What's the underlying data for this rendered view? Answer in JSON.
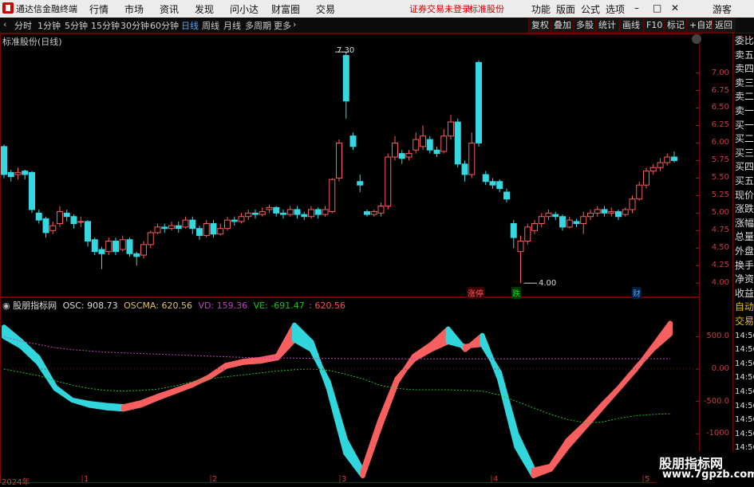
{
  "app": {
    "title": "通达信金融终端",
    "guest": "游客"
  },
  "menu": [
    "行情",
    "市场",
    "资讯",
    "发现",
    "问小达",
    "财富圈",
    "交易"
  ],
  "notice": {
    "login": "证券交易未登录",
    "stock": "标准股份"
  },
  "menu_right": [
    "功能",
    "版面",
    "公式",
    "选项"
  ],
  "periods": [
    "分时",
    "1分钟",
    "5分钟",
    "15分钟",
    "30分钟",
    "60分钟",
    "日线",
    "周线",
    "月线",
    "多周期",
    "更多"
  ],
  "active_period": "日线",
  "tool_buttons": [
    "复权",
    "叠加",
    "多股",
    "统计",
    "画线",
    "F10",
    "标记",
    "+自选",
    "返回"
  ],
  "chart_title": "标准股份(日线)",
  "colors": {
    "up": "#ff5a5a",
    "down": "#35d7e0",
    "osc_up": "#f86060",
    "osc_down": "#30d6dc",
    "vd": "#c040c0",
    "ve": "#20c020",
    "accent": "#4aa3ff"
  },
  "price_axis": [
    "7.00",
    "6.75",
    "6.50",
    "6.25",
    "6.00",
    "5.75",
    "5.50",
    "5.25",
    "5.00",
    "4.75",
    "4.50",
    "4.25",
    "4.00"
  ],
  "price_high_label": "7.30",
  "price_low_label": "4.00",
  "event_tags": [
    "涨停",
    "跌",
    "财"
  ],
  "indicator": {
    "name": "股朋指标网",
    "osc_label": "OSC: 908.73",
    "oscma_label": "OSCMA: 620.56",
    "vd_label": "VD: 159.36",
    "ve_label": "VE: -691.47",
    "extra_label": ": 620.56"
  },
  "osc_axis": [
    "500.0",
    "0.00",
    "-500.0",
    "-1000",
    "-1500"
  ],
  "date_axis": [
    "2024年",
    "1",
    "2",
    "3",
    "4",
    "5"
  ],
  "sidebar": [
    "委比",
    "卖五",
    "卖四",
    "卖三",
    "卖二",
    "卖一",
    "买一",
    "买二",
    "买三",
    "买四",
    "买五",
    "现价",
    "涨跌",
    "涨幅",
    "总量",
    "外盘",
    "换手",
    "净资",
    "收益",
    "自动",
    "交易",
    "14:56",
    "14:56",
    "14:56",
    "14:56",
    "14:56",
    "14:56",
    "14:56",
    "14:56",
    "14:56",
    "14:56"
  ],
  "watermark": {
    "line1": "股朋指标网",
    "line2": "www.7gpzb.com"
  },
  "chart_data": [
    {
      "type": "candlestick",
      "title": "标准股份(日线)",
      "ylim": [
        3.9,
        7.45
      ],
      "candles": [
        [
          5.95,
          5.55,
          5.98,
          5.5
        ],
        [
          5.58,
          5.52,
          5.62,
          5.45
        ],
        [
          5.55,
          5.58,
          5.65,
          5.48
        ],
        [
          5.6,
          5.55,
          5.62,
          5.48
        ],
        [
          5.58,
          5.05,
          5.6,
          5.0
        ],
        [
          5.0,
          4.9,
          5.05,
          4.85
        ],
        [
          4.92,
          4.72,
          4.95,
          4.65
        ],
        [
          4.75,
          4.82,
          4.88,
          4.7
        ],
        [
          4.85,
          5.02,
          5.1,
          4.8
        ],
        [
          5.0,
          4.95,
          5.05,
          4.88
        ],
        [
          4.95,
          4.85,
          4.98,
          4.78
        ],
        [
          4.88,
          4.88,
          4.95,
          4.8
        ],
        [
          4.88,
          4.6,
          4.9,
          4.52
        ],
        [
          4.62,
          4.45,
          4.65,
          4.4
        ],
        [
          4.48,
          4.42,
          4.52,
          4.2
        ],
        [
          4.45,
          4.6,
          4.65,
          4.4
        ],
        [
          4.6,
          4.45,
          4.65,
          4.4
        ],
        [
          4.48,
          4.62,
          4.68,
          4.45
        ],
        [
          4.62,
          4.42,
          4.65,
          4.38
        ],
        [
          4.42,
          4.38,
          4.45,
          4.25
        ],
        [
          4.4,
          4.55,
          4.6,
          4.35
        ],
        [
          4.55,
          4.72,
          4.75,
          4.5
        ],
        [
          4.72,
          4.8,
          4.85,
          4.7
        ],
        [
          4.8,
          4.78,
          4.85,
          4.72
        ],
        [
          4.78,
          4.82,
          4.88,
          4.75
        ],
        [
          4.82,
          4.78,
          4.88,
          4.72
        ],
        [
          4.8,
          4.9,
          4.95,
          4.78
        ],
        [
          4.9,
          4.78,
          4.95,
          4.7
        ],
        [
          4.78,
          4.68,
          4.82,
          4.62
        ],
        [
          4.68,
          4.85,
          4.9,
          4.65
        ],
        [
          4.85,
          4.7,
          4.9,
          4.65
        ],
        [
          4.7,
          4.78,
          4.85,
          4.68
        ],
        [
          4.78,
          4.9,
          4.95,
          4.75
        ],
        [
          4.9,
          4.88,
          4.95,
          4.82
        ],
        [
          4.88,
          4.95,
          5.0,
          4.85
        ],
        [
          4.95,
          5.0,
          5.05,
          4.9
        ],
        [
          5.0,
          4.98,
          5.05,
          4.92
        ],
        [
          4.98,
          5.02,
          5.08,
          4.95
        ],
        [
          5.05,
          5.08,
          5.12,
          5.0
        ],
        [
          5.08,
          5.0,
          5.1,
          4.95
        ],
        [
          5.0,
          4.98,
          5.05,
          4.92
        ],
        [
          4.98,
          5.05,
          5.1,
          4.95
        ],
        [
          5.05,
          4.98,
          5.1,
          4.92
        ],
        [
          4.98,
          4.95,
          5.02,
          4.9
        ],
        [
          4.95,
          5.05,
          5.1,
          4.92
        ],
        [
          5.05,
          4.98,
          5.08,
          4.92
        ],
        [
          4.98,
          5.05,
          5.1,
          4.95
        ],
        [
          5.02,
          5.48,
          5.5,
          5.0
        ],
        [
          5.5,
          6.0,
          6.05,
          5.45
        ],
        [
          7.25,
          6.6,
          7.3,
          6.35
        ],
        [
          6.1,
          5.95,
          6.15,
          5.9
        ],
        [
          5.45,
          5.4,
          5.55,
          5.3
        ],
        [
          5.02,
          4.98,
          5.05,
          4.95
        ],
        [
          4.98,
          5.02,
          5.05,
          4.95
        ],
        [
          5.0,
          5.1,
          5.15,
          4.95
        ],
        [
          5.1,
          5.8,
          5.85,
          5.05
        ],
        [
          5.8,
          6.0,
          6.1,
          5.75
        ],
        [
          5.85,
          5.78,
          5.9,
          5.7
        ],
        [
          5.8,
          5.85,
          5.9,
          5.75
        ],
        [
          5.9,
          6.05,
          6.15,
          5.85
        ],
        [
          5.95,
          6.1,
          6.25,
          5.9
        ],
        [
          6.05,
          5.9,
          6.1,
          5.85
        ],
        [
          5.9,
          5.85,
          5.95,
          5.8
        ],
        [
          5.88,
          6.1,
          6.2,
          5.85
        ],
        [
          6.1,
          6.3,
          6.4,
          6.05
        ],
        [
          6.3,
          5.7,
          6.35,
          5.65
        ],
        [
          5.7,
          5.55,
          5.75,
          5.45
        ],
        [
          5.55,
          6.0,
          6.15,
          5.5
        ],
        [
          7.15,
          6.0,
          7.18,
          5.95
        ],
        [
          5.55,
          5.45,
          5.6,
          5.4
        ],
        [
          5.45,
          5.4,
          5.5,
          5.35
        ],
        [
          5.45,
          5.35,
          5.48,
          5.3
        ],
        [
          5.3,
          5.2,
          5.35,
          5.15
        ],
        [
          4.85,
          4.65,
          4.9,
          4.5
        ],
        [
          4.45,
          4.6,
          4.68,
          4.0
        ],
        [
          4.6,
          4.8,
          4.85,
          4.55
        ],
        [
          4.75,
          4.85,
          4.9,
          4.7
        ],
        [
          4.85,
          4.95,
          5.0,
          4.8
        ],
        [
          4.95,
          5.0,
          5.05,
          4.9
        ],
        [
          4.98,
          4.95,
          5.02,
          4.9
        ],
        [
          4.95,
          4.8,
          4.98,
          4.75
        ],
        [
          4.8,
          4.9,
          4.95,
          4.78
        ],
        [
          4.88,
          4.85,
          4.92,
          4.8
        ],
        [
          4.85,
          4.95,
          5.02,
          4.7
        ],
        [
          4.95,
          5.0,
          5.05,
          4.9
        ],
        [
          5.0,
          5.05,
          5.1,
          4.95
        ],
        [
          5.05,
          5.0,
          5.1,
          4.95
        ],
        [
          5.0,
          5.02,
          5.08,
          4.95
        ],
        [
          5.02,
          4.95,
          5.05,
          4.9
        ],
        [
          4.98,
          5.05,
          5.08,
          4.95
        ],
        [
          5.05,
          5.2,
          5.25,
          5.0
        ],
        [
          5.2,
          5.4,
          5.45,
          5.18
        ],
        [
          5.4,
          5.6,
          5.65,
          5.35
        ],
        [
          5.6,
          5.65,
          5.7,
          5.55
        ],
        [
          5.65,
          5.72,
          5.78,
          5.6
        ],
        [
          5.72,
          5.8,
          5.85,
          5.68
        ],
        [
          5.8,
          5.75,
          5.88,
          5.72
        ]
      ]
    },
    {
      "type": "band",
      "title": "股朋指标网",
      "ylim": [
        -1650,
        850
      ],
      "osc": [
        650,
        430,
        180,
        -280,
        -480,
        -560,
        -600,
        -620,
        -560,
        -450,
        -350,
        -250,
        -120,
        60,
        120,
        150,
        200,
        680,
        420,
        -300,
        -1300,
        -1650,
        -900,
        -200,
        200,
        380,
        620,
        300,
        520,
        -150,
        -1200,
        -1650,
        -1550,
        -1200,
        -900,
        -600,
        -300,
        0,
        350,
        710
      ],
      "oscma": [
        500,
        350,
        100,
        -300,
        -480,
        -530,
        -560,
        -580,
        -520,
        -420,
        -330,
        -240,
        -130,
        40,
        100,
        120,
        170,
        450,
        300,
        -200,
        -1100,
        -1580,
        -800,
        -150,
        150,
        300,
        420,
        350,
        380,
        -50,
        -1000,
        -1560,
        -1500,
        -1100,
        -850,
        -560,
        -290,
        20,
        310,
        540
      ],
      "vd": [
        500,
        430,
        380,
        330,
        300,
        280,
        260,
        250,
        240,
        230,
        220,
        210,
        200,
        190,
        180,
        175,
        170,
        170,
        165,
        165,
        160,
        160,
        160,
        158,
        158,
        158,
        157,
        157,
        157,
        158,
        158,
        158,
        159,
        159,
        159,
        159,
        159,
        159,
        159,
        159
      ],
      "ve": [
        0,
        -50,
        -100,
        -180,
        -250,
        -300,
        -330,
        -340,
        -330,
        -310,
        -260,
        -200,
        -150,
        -120,
        -90,
        -60,
        -30,
        -10,
        0,
        -20,
        -80,
        -150,
        -250,
        -300,
        -320,
        -320,
        -320,
        -330,
        -340,
        -400,
        -500,
        -600,
        -700,
        -780,
        -830,
        -820,
        -760,
        -720,
        -700,
        -691
      ]
    }
  ]
}
